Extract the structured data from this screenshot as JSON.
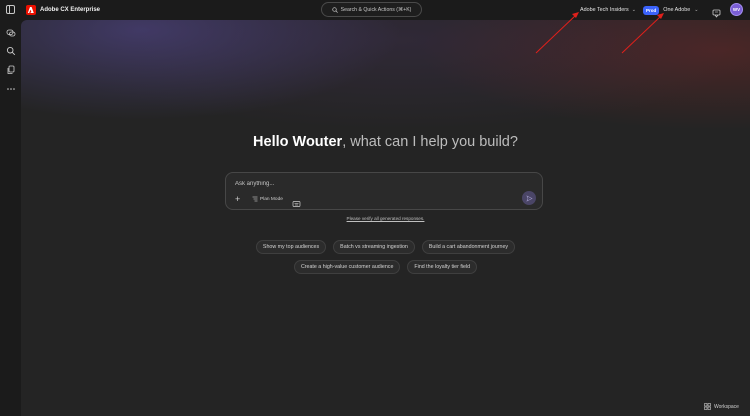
{
  "app": {
    "name": "Adobe CX Enterprise",
    "brand_color": "#eb1000"
  },
  "header": {
    "search_placeholder": "Search & Quick Actions (⌘+K)",
    "org_name": "Adobe Tech Insiders",
    "env_badge": "Prod",
    "env_badge_color": "#3b63fb",
    "sandbox_name": "One Adobe",
    "avatar_initials": "WV",
    "avatar_color": "#7b5fd6"
  },
  "rail": {
    "items": [
      {
        "icon": "chat-bubbles-icon"
      },
      {
        "icon": "search-icon"
      },
      {
        "icon": "files-icon"
      },
      {
        "icon": "more-icon"
      }
    ]
  },
  "hero": {
    "greeting_name": "Hello Wouter",
    "greeting_rest": ", what can I help you build?"
  },
  "prompt": {
    "placeholder": "Ask anything...",
    "plan_mode_label": "Plan Mode"
  },
  "verify_text": "Please verify all generated responses.",
  "suggestions": {
    "row1": [
      "Show my top audiences",
      "Batch vs streaming ingestion",
      "Build a cart abandonment journey"
    ],
    "row2": [
      "Create a high-value customer audience",
      "Find the loyalty tier field"
    ]
  },
  "footer": {
    "workspace_label": "Workspace"
  },
  "annotation_color": "#e0201b"
}
